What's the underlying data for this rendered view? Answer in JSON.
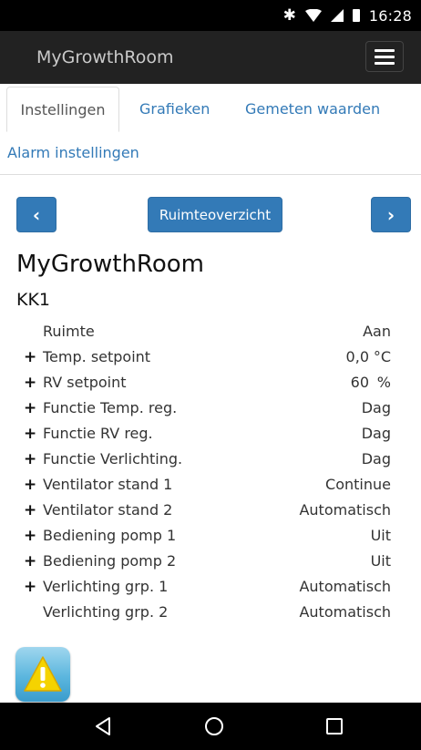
{
  "status_bar": {
    "time": "16:28",
    "icons": [
      "bluetooth-icon",
      "wifi-icon",
      "signal-icon",
      "battery-icon"
    ]
  },
  "navbar": {
    "brand": "MyGrowthRoom",
    "menu_icon": "hamburger-menu-icon"
  },
  "tabs": [
    {
      "label": "Instellingen",
      "active": true
    },
    {
      "label": "Grafieken",
      "active": false
    },
    {
      "label": "Gemeten waarden",
      "active": false
    },
    {
      "label": "Alarm instellingen",
      "active": false
    }
  ],
  "nav_buttons": {
    "prev_icon": "chevron-left-icon",
    "center_label": "Ruimteoverzicht",
    "next_icon": "chevron-right-icon"
  },
  "room": {
    "title": "MyGrowthRoom",
    "subtitle": "KK1"
  },
  "settings": [
    {
      "expandable": false,
      "label": "Ruimte",
      "value": "Aan",
      "unit": ""
    },
    {
      "expandable": true,
      "label": "Temp. setpoint",
      "value": "0,0",
      "unit": "°C"
    },
    {
      "expandable": true,
      "label": "RV setpoint",
      "value": "60",
      "unit": "%"
    },
    {
      "expandable": true,
      "label": "Functie Temp. reg.",
      "value": "Dag",
      "unit": ""
    },
    {
      "expandable": true,
      "label": "Functie RV reg.",
      "value": "Dag",
      "unit": ""
    },
    {
      "expandable": true,
      "label": "Functie Verlichting.",
      "value": "Dag",
      "unit": ""
    },
    {
      "expandable": true,
      "label": "Ventilator stand 1",
      "value": "Continue",
      "unit": ""
    },
    {
      "expandable": true,
      "label": "Ventilator stand 2",
      "value": "Automatisch",
      "unit": ""
    },
    {
      "expandable": true,
      "label": "Bediening pomp 1",
      "value": "Uit",
      "unit": ""
    },
    {
      "expandable": true,
      "label": "Bediening pomp 2",
      "value": "Uit",
      "unit": ""
    },
    {
      "expandable": true,
      "label": "Verlichting grp. 1",
      "value": "Automatisch",
      "unit": ""
    },
    {
      "expandable": false,
      "label": "Verlichting grp. 2",
      "value": "Automatisch",
      "unit": ""
    }
  ],
  "plus_symbol": "+",
  "alarm_icon": "warning-icon",
  "colors": {
    "primary": "#337ab7",
    "navbar": "#222222",
    "link": "#337ab7"
  }
}
